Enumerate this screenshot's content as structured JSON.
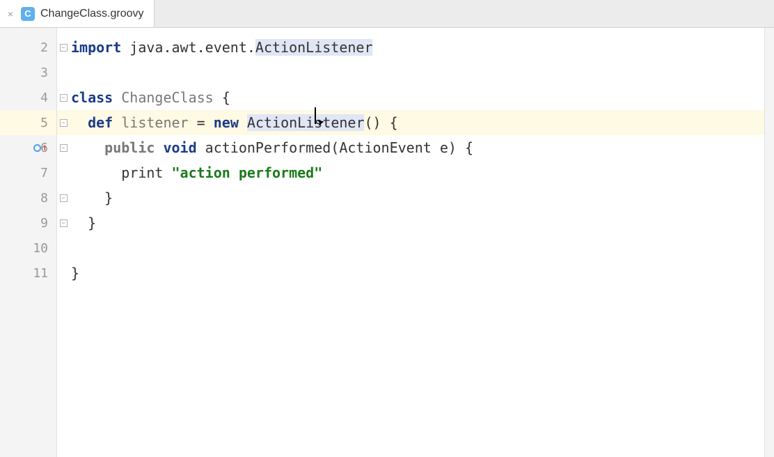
{
  "tab": {
    "close_glyph": "×",
    "icon_letter": "C",
    "filename": "ChangeClass.groovy"
  },
  "gutter": {
    "lines": [
      "2",
      "3",
      "4",
      "5",
      "6",
      "7",
      "8",
      "9",
      "10",
      "11"
    ],
    "current_index": 3,
    "marker_index": 4
  },
  "fold": {
    "handles": {
      "0": "−",
      "2": "−",
      "3": "−",
      "4": "−",
      "6": "−",
      "7": "−"
    }
  },
  "code": {
    "l2": {
      "kw": "import",
      "pkg": " java.awt.event.",
      "cls": "ActionListener"
    },
    "l4": {
      "kw": "class",
      "name": " ChangeClass ",
      "brace": "{"
    },
    "l5": {
      "pre": "  ",
      "kw": "def",
      "name": " listener ",
      "eq": "= ",
      "kw2": "new",
      "sp": " ",
      "cls": "ActionListener",
      "post": "() {"
    },
    "l6": {
      "pre": "    ",
      "kw": "public",
      "sp": " ",
      "kw2": "void",
      "rest": " actionPerformed(ActionEvent e) {"
    },
    "l7": {
      "pre": "      print ",
      "str": "\"action performed\""
    },
    "l8": "    }",
    "l9": "  }",
    "l11": "}"
  }
}
